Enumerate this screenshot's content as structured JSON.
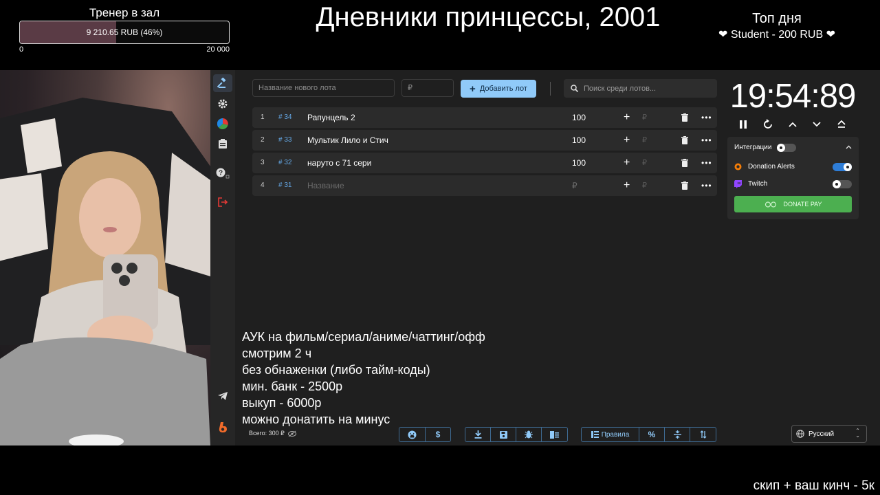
{
  "goal": {
    "title": "Тренер в зал",
    "progress_text": "9 210.65 RUB (46%)",
    "progress_fraction": 0.46,
    "min_label": "0",
    "max_label": "20 000"
  },
  "stream_title": "Дневники принцессы, 2001",
  "top_day": {
    "title": "Топ дня",
    "entry": "❤ Student - 200 RUB ❤"
  },
  "sidebar": {
    "items": [
      {
        "icon": "gavel-icon"
      },
      {
        "icon": "gear-icon"
      },
      {
        "icon": "pie-chart-icon"
      },
      {
        "icon": "clipboard-icon"
      },
      {
        "icon": "help-icon"
      },
      {
        "icon": "logout-icon"
      },
      {
        "icon": "telegram-icon"
      },
      {
        "icon": "boosty-icon"
      }
    ]
  },
  "toolbar": {
    "new_lot_placeholder": "Название нового лота",
    "amount_placeholder": "₽",
    "add_button": "Добавить лот",
    "search_placeholder": "Поиск среди лотов..."
  },
  "lots": [
    {
      "index": "1",
      "id": "# 34",
      "name": "Рапунцель 2",
      "amount": "100",
      "currency": "₽"
    },
    {
      "index": "2",
      "id": "# 33",
      "name": "Мультик Лило и Стич",
      "amount": "100",
      "currency": "₽"
    },
    {
      "index": "3",
      "id": "# 32",
      "name": "наруто с 71 сери",
      "amount": "100",
      "currency": "₽"
    },
    {
      "index": "4",
      "id": "# 31",
      "name_placeholder": "Название",
      "amount_placeholder": "₽",
      "currency": "₽"
    }
  ],
  "timer": {
    "display": "19:54:89"
  },
  "integrations": {
    "title": "Интеграции",
    "items": [
      {
        "name": "Donation Alerts",
        "enabled": true
      },
      {
        "name": "Twitch",
        "enabled": false
      }
    ],
    "donate_button": "DONATE PAY"
  },
  "rules_text": [
    "АУК на фильм/сериал/аниме/чаттинг/офф",
    "смотрим 2 ч",
    "без обнаженки (либо тайм-коды)",
    "мин. банк - 2500р",
    "выкуп - 6000р",
    "можно донатить на минус"
  ],
  "footer": {
    "total": "Всего: 300 ₽",
    "rules_button": "Правила",
    "percent_label": "%",
    "language": "Русский"
  },
  "ticker": "скип + ваш кинч - 5к",
  "colors": {
    "accent": "#90caf9",
    "donate": "#4caf50",
    "id_color": "#64a8e6",
    "toggle_on": "#2e7dd7"
  }
}
